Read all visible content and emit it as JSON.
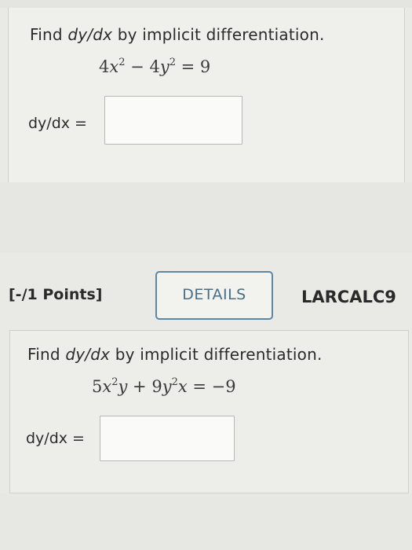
{
  "question1": {
    "prompt_pre": "Find ",
    "prompt_var": "dy/dx",
    "prompt_post": " by implicit differentiation.",
    "eq_a": "4",
    "eq_x": "x",
    "eq_exp1": "2",
    "eq_mid": " − 4",
    "eq_y": "y",
    "eq_exp2": "2",
    "eq_rhs": " = 9",
    "answer_label": "dy/dx =",
    "answer_value": ""
  },
  "header2": {
    "points": "[-/1 Points]",
    "details_label": "DETAILS",
    "course_code": "LARCALC9"
  },
  "question2": {
    "prompt_pre": "Find ",
    "prompt_var": "dy/dx",
    "prompt_post": " by implicit differentiation.",
    "eq_a": "5",
    "eq_x1": "x",
    "eq_exp1": "2",
    "eq_y1": "y",
    "eq_mid": " + 9",
    "eq_y2": "y",
    "eq_exp2": "2",
    "eq_x2": "x",
    "eq_rhs": " = −9",
    "answer_label": "dy/dx =",
    "answer_value": ""
  }
}
